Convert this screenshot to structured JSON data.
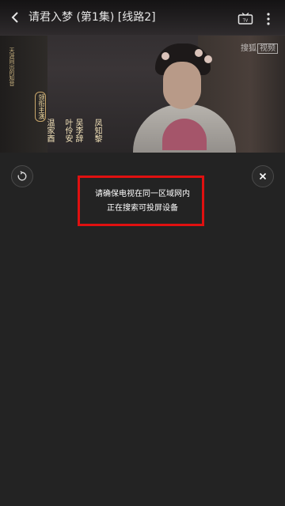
{
  "header": {
    "title": "请君入梦 (第1集) [线路2]",
    "back_icon": "chevron-left-icon",
    "tv_icon": "tv-icon",
    "more_icon": "more-vertical-icon"
  },
  "video": {
    "watermark_prefix": "搜狐",
    "watermark_box": "视频",
    "credits_small": "天涯同出的知音",
    "credit_head": "领衔主演",
    "credit_columns": [
      "温家酉",
      "叶伶安",
      "吴李辞",
      "凤知黎"
    ]
  },
  "cast_panel": {
    "message_line1": "请确保电视在同一区域网内",
    "message_line2": "正在搜索可投屏设备",
    "refresh_icon": "refresh-icon",
    "close_icon": "close-icon",
    "highlight_color": "#e01010"
  }
}
